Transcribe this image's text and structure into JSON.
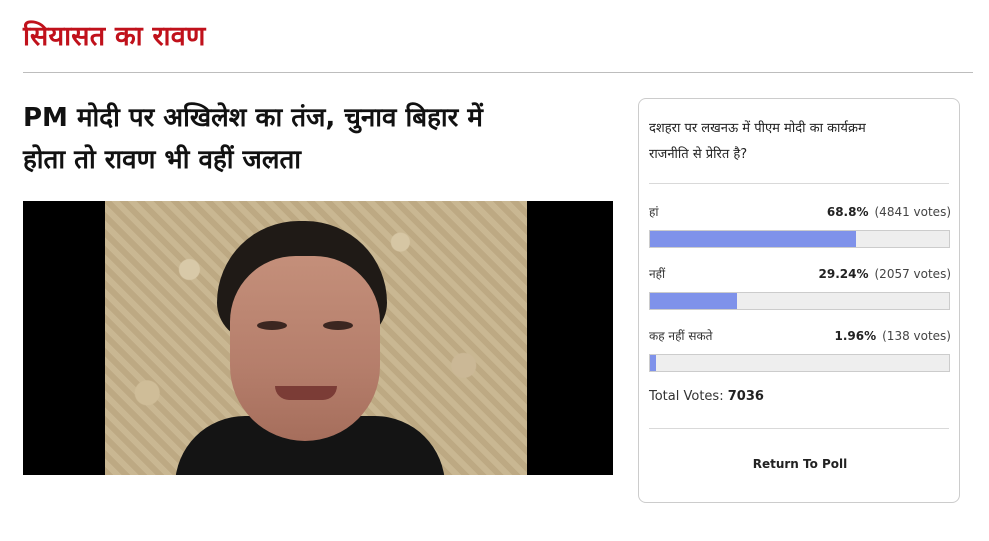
{
  "section": {
    "title": "सियासत का रावण"
  },
  "article": {
    "headline_line1": "PM मोदी पर अखिलेश का तंज, चुनाव बिहार में",
    "headline_line2": "होता तो रावण भी वहीं जलता"
  },
  "poll": {
    "question_line1": "दशहरा पर लखनऊ में पीएम मोदी का कार्यक्रम",
    "question_line2": "राजनीति से प्रेरित है?",
    "answers": [
      {
        "label": "हां",
        "percent": "68.8%",
        "votes": "(4841 votes)",
        "fraction": 0.688
      },
      {
        "label": "नहीं",
        "percent": "29.24%",
        "votes": "(2057 votes)",
        "fraction": 0.2924
      },
      {
        "label": "कह नहीं सकते",
        "percent": "1.96%",
        "votes": "(138 votes)",
        "fraction": 0.0196
      }
    ],
    "total_label": "Total Votes:",
    "total_value": "7036",
    "return_label": "Return To Poll",
    "bar_color": "#7f92ea"
  },
  "colors": {
    "section_title": "#c0111b"
  }
}
